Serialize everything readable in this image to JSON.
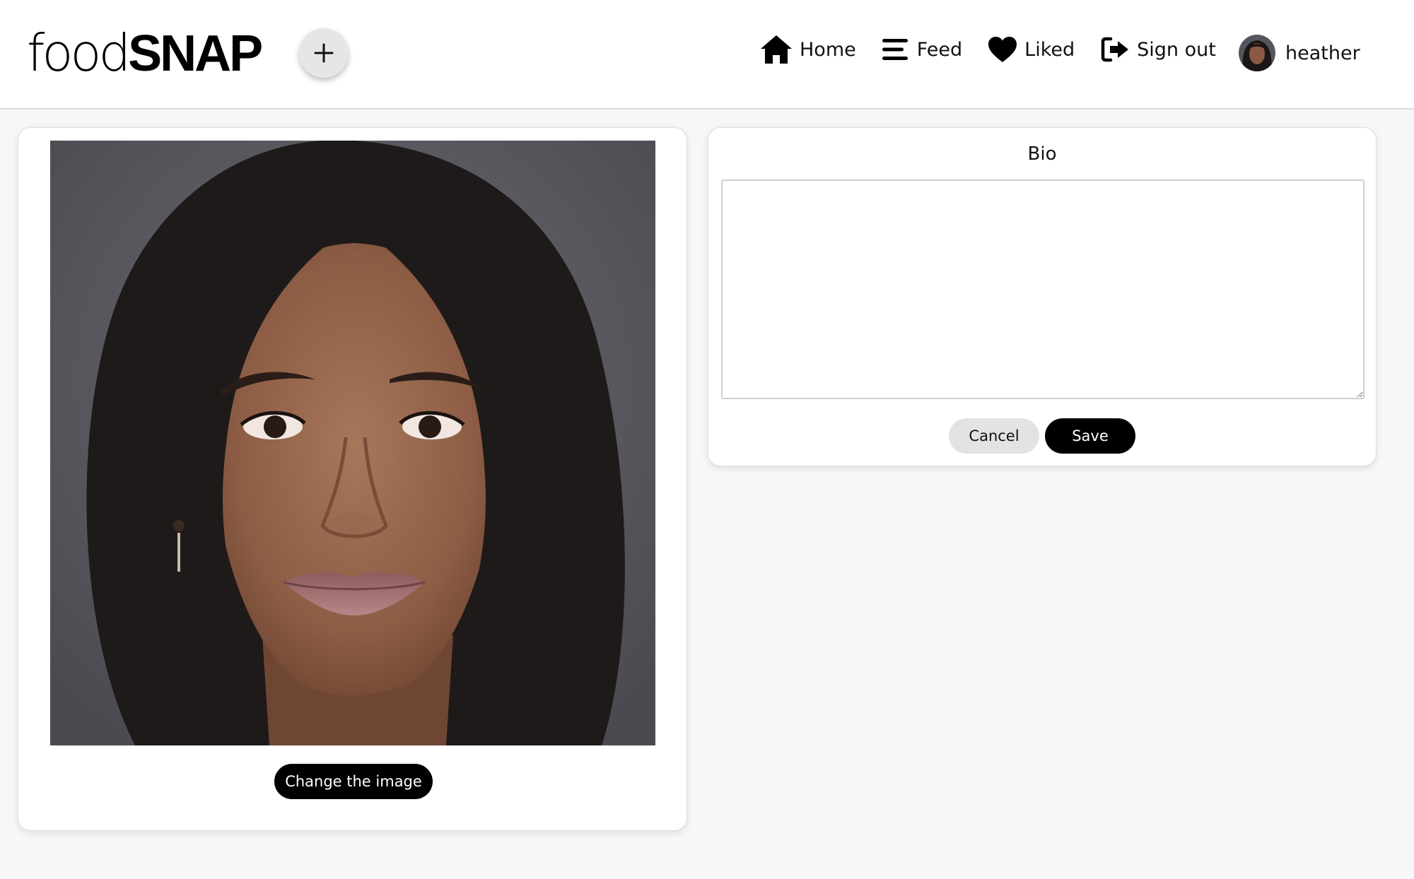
{
  "header": {
    "logo": {
      "light": "food",
      "bold": "SNAP"
    },
    "add_icon": "plus-icon",
    "nav": [
      {
        "label": "Home",
        "icon": "home-icon"
      },
      {
        "label": "Feed",
        "icon": "menu-lines-icon"
      },
      {
        "label": "Liked",
        "icon": "heart-icon"
      },
      {
        "label": "Sign out",
        "icon": "sign-out-icon"
      }
    ],
    "user": {
      "name": "heather"
    }
  },
  "profile_image": {
    "change_label": "Change the image"
  },
  "bio": {
    "title": "Bio",
    "value": "",
    "cancel_label": "Cancel",
    "save_label": "Save"
  },
  "colors": {
    "background": "#f7f7f7",
    "card": "#ffffff",
    "primary_button": "#000000",
    "secondary_button": "#e3e3e3"
  }
}
